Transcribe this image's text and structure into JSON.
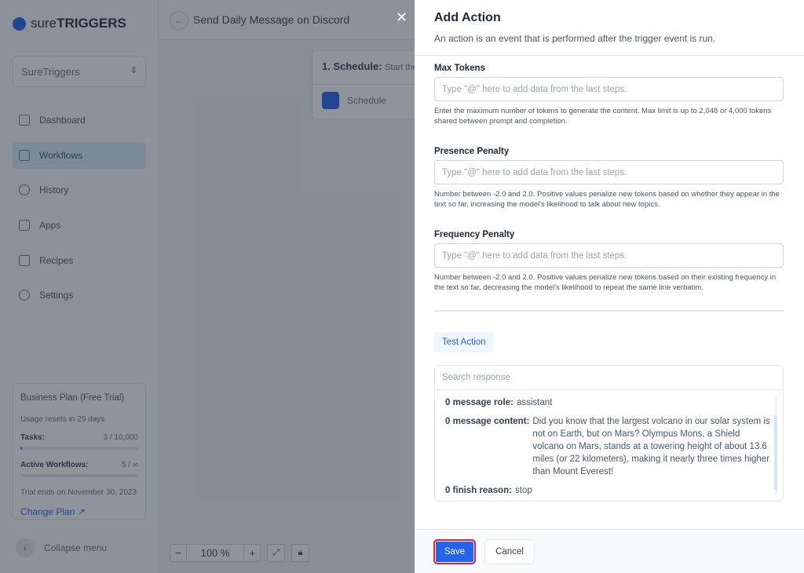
{
  "brand": {
    "logo_prefix": "sure",
    "logo_suffix": "TRIGGERS"
  },
  "workspace": "SureTriggers",
  "nav": [
    {
      "label": "Dashboard",
      "icon": "grid-icon"
    },
    {
      "label": "Workflows",
      "icon": "workflow-icon",
      "active": true
    },
    {
      "label": "History",
      "icon": "history-icon"
    },
    {
      "label": "Apps",
      "icon": "apps-icon"
    },
    {
      "label": "Recipes",
      "icon": "recipes-icon"
    },
    {
      "label": "Settings",
      "icon": "gear-icon"
    }
  ],
  "plan": {
    "title": "Business Plan (Free Trial)",
    "resets": "Usage resets in 29 days",
    "tasks_label": "Tasks:",
    "tasks_value": "3 / 10,000",
    "tasks_fraction": 0.0003,
    "workflows_label": "Active Workflows:",
    "workflows_value": "5 / ∞",
    "trial": "Trial ends on November 30, 2023",
    "change": "Change Plan"
  },
  "collapse": "Collapse menu",
  "workflow": {
    "title": "Send Daily Message on Discord",
    "step_title": "1. Schedule:",
    "step_sub": "Start the",
    "step_app": "Schedule"
  },
  "zoom": {
    "minus": "−",
    "value": "100 %",
    "plus": "+"
  },
  "panel": {
    "title": "Add Action",
    "subtitle": "An action is an event that is performed after the trigger event is run.",
    "fields": [
      {
        "label": "Max Tokens",
        "placeholder": "Type \"@\" here to add data from the last steps.",
        "help": "Enter the maximum number of tokens to generate the content. Max limit is up to 2,048 or 4,000 tokens shared between prompt and completion."
      },
      {
        "label": "Presence Penalty",
        "placeholder": "Type \"@\" here to add data from the last steps.",
        "help": "Number between -2.0 and 2.0. Positive values penalize new tokens based on whether they appear in the text so far, increasing the model's likelihood to talk about new topics."
      },
      {
        "label": "Frequency Penalty",
        "placeholder": "Type \"@\" here to add data from the last steps.",
        "help": "Number between -2.0 and 2.0. Positive values penalize new tokens based on their existing frequency in the text so far, decreasing the model's likelihood to repeat the same line verbatim."
      }
    ],
    "test_action": "Test Action",
    "search_placeholder": "Search response",
    "response": [
      {
        "key": "0 message role:",
        "value": "assistant"
      },
      {
        "key": "0 message content:",
        "value": "Did you know that the largest volcano in our solar system is not on Earth, but on Mars? Olympus Mons, a Shield volcano on Mars, stands at a towering height of about 13.6 miles (or 22 kilometers), making it nearly three times higher than Mount Everest!"
      },
      {
        "key": "0 finish reason:",
        "value": "stop"
      }
    ],
    "save": "Save",
    "cancel": "Cancel"
  },
  "colors": {
    "accent": "#2563eb",
    "focus_ring": "#e11d48"
  }
}
